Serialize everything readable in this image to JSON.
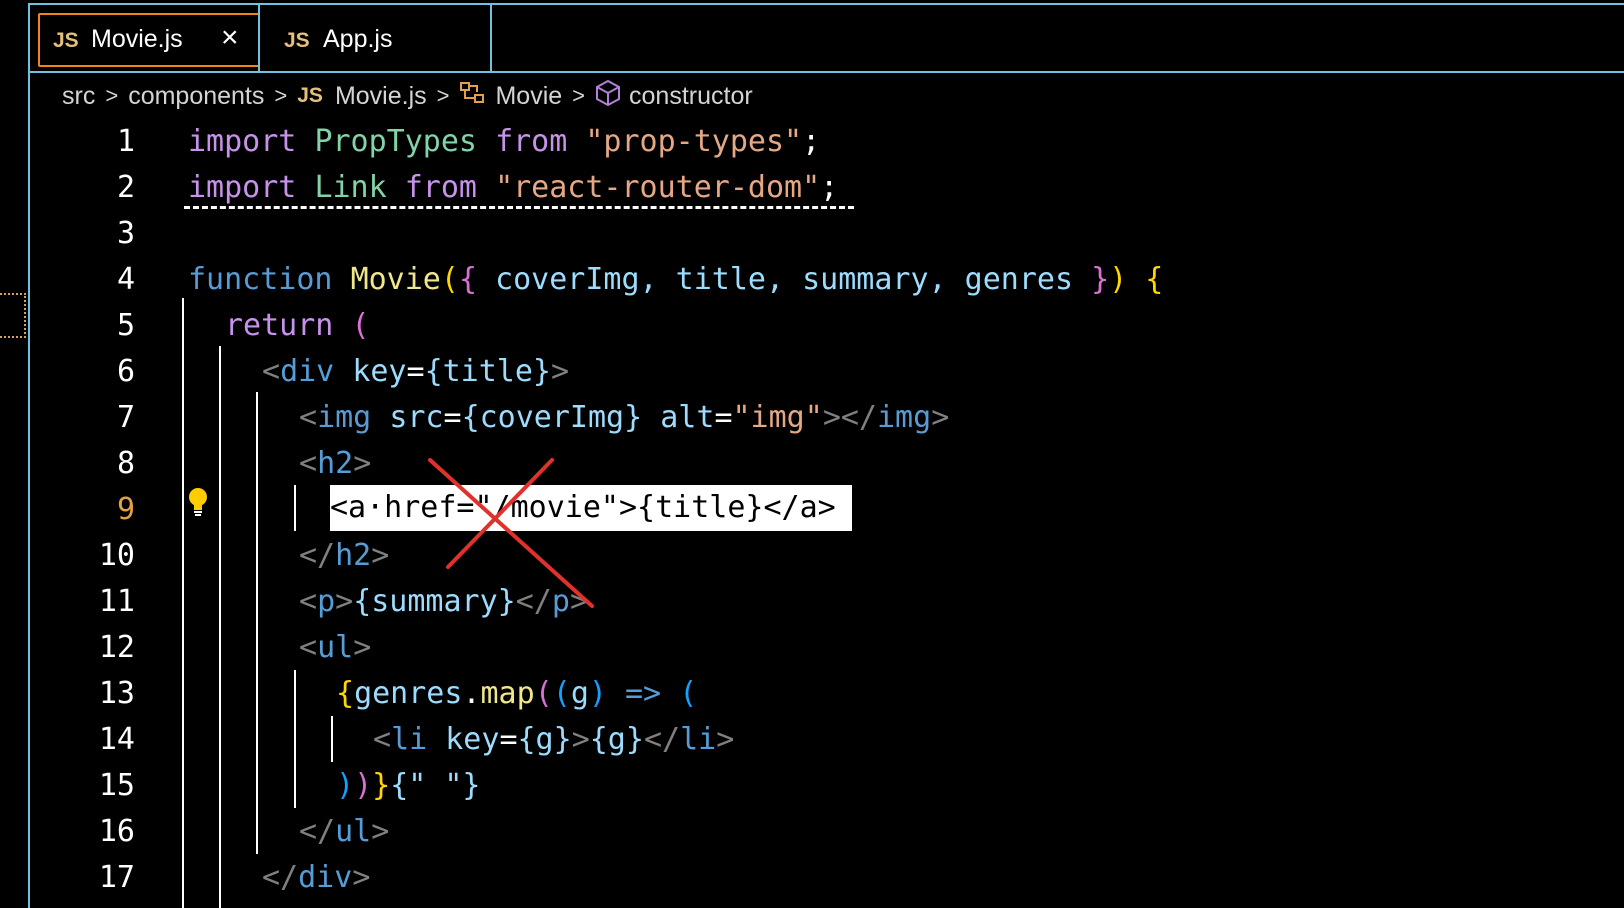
{
  "tabs": [
    {
      "icon": "JS",
      "label": "Movie.js",
      "active": true,
      "close": "×"
    },
    {
      "icon": "JS",
      "label": "App.js",
      "active": false
    }
  ],
  "breadcrumb": {
    "items": [
      "src",
      "components",
      "Movie.js",
      "Movie",
      "constructor"
    ],
    "js_icon": "JS",
    "separator": ">"
  },
  "line_numbers": [
    "1",
    "2",
    "3",
    "4",
    "5",
    "6",
    "7",
    "8",
    "9",
    "10",
    "11",
    "12",
    "13",
    "14",
    "15",
    "16",
    "17"
  ],
  "active_line": "9",
  "code": {
    "l1": {
      "kw1": "import",
      "id": "PropTypes",
      "kw2": "from",
      "str": "\"prop-types\"",
      "end": ";"
    },
    "l2": {
      "kw1": "import",
      "id": "Link",
      "kw2": "from",
      "str": "\"react-router-dom\"",
      "end": ";"
    },
    "l4": {
      "kw": "function",
      "fn": "Movie",
      "p1": "(",
      "b1": "{",
      "params": "coverImg, title, summary, genres",
      "b2": "}",
      "p2": ")",
      "b3": "{"
    },
    "l5": {
      "kw": "return",
      "p": "("
    },
    "l6": {
      "lt": "<",
      "tag": "div",
      "attr": "key",
      "eq": "=",
      "val": "{title}",
      "gt": ">"
    },
    "l7": {
      "lt": "<",
      "tag": "img",
      "attr1": "src",
      "val1": "{coverImg}",
      "attr2": "alt",
      "val2": "\"img\"",
      "close": "></",
      "tag2": "img",
      "gt": ">"
    },
    "l8": {
      "lt": "<",
      "tag": "h2",
      "gt": ">"
    },
    "l9": {
      "text": "<a·href=\"/movie\">{title}</a>"
    },
    "l10": {
      "lt": "</",
      "tag": "h2",
      "gt": ">"
    },
    "l11": {
      "lt": "<",
      "tag": "p",
      "gt": ">",
      "val": "{summary}",
      "lt2": "</",
      "tag2": "p",
      "gt2": ">"
    },
    "l12": {
      "lt": "<",
      "tag": "ul",
      "gt": ">"
    },
    "l13": {
      "b": "{",
      "id": "genres",
      "dot": ".",
      "fn": "map",
      "p1": "(",
      "p2": "(",
      "param": "g",
      "p3": ")",
      "arrow": "=>",
      "p4": "("
    },
    "l14": {
      "lt": "<",
      "tag": "li",
      "attr": "key",
      "val1": "{g}",
      "gt": ">",
      "val2": "{g}",
      "lt2": "</",
      "tag2": "li",
      "gt2": ">"
    },
    "l15": {
      "p1": ")",
      "p2": ")",
      "b": "}",
      "str": "{\" \"}"
    },
    "l16": {
      "lt": "</",
      "tag": "ul",
      "gt": ">"
    },
    "l17": {
      "lt": "</",
      "tag": "div",
      "gt": ">"
    }
  },
  "colors": {
    "accent_border": "#6fc3df",
    "active_tab_border": "#f38518",
    "annotation_red": "#e0312b"
  }
}
